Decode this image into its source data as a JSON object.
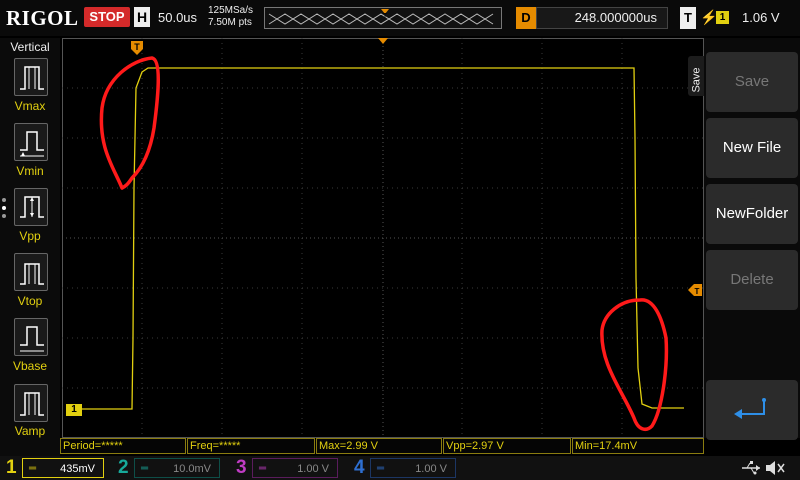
{
  "header": {
    "logo": "RIGOL",
    "run_state": "STOP",
    "timebase_label": "H",
    "timebase_value": "50.0us",
    "sample_rate": "125MSa/s",
    "memory_depth": "7.50M pts",
    "delay_label": "D",
    "delay_value": "248.000000us",
    "trigger_label": "T",
    "trigger_channel": "1",
    "trigger_level": "1.06 V"
  },
  "left_menu": {
    "title": "Vertical",
    "items": [
      {
        "label": "Vmax",
        "icon": "vmax-icon"
      },
      {
        "label": "Vmin",
        "icon": "vmin-icon"
      },
      {
        "label": "Vpp",
        "icon": "vpp-icon"
      },
      {
        "label": "Vtop",
        "icon": "vtop-icon"
      },
      {
        "label": "Vbase",
        "icon": "vbase-icon"
      },
      {
        "label": "Vamp",
        "icon": "vamp-icon"
      }
    ]
  },
  "right_menu": {
    "title": "Save",
    "buttons": [
      {
        "label": "Save",
        "enabled": false
      },
      {
        "label": "New File",
        "enabled": true
      },
      {
        "label": "NewFolder",
        "enabled": true
      },
      {
        "label": "Delete",
        "enabled": false
      },
      {
        "label": "",
        "icon": "enter-icon",
        "enabled": true
      }
    ]
  },
  "channel_markers": {
    "ch1_ground": "1"
  },
  "measurements": [
    {
      "text": "Period=*****"
    },
    {
      "text": "Freq=*****"
    },
    {
      "text": "Max=2.99 V"
    },
    {
      "text": "Vpp=2.97 V"
    },
    {
      "text": "Min=17.4mV"
    }
  ],
  "channels": [
    {
      "num": "1",
      "scale": "435mV",
      "color": "#e2d010",
      "active": true
    },
    {
      "num": "2",
      "scale": "10.0mV",
      "color": "#17a99a",
      "active": false
    },
    {
      "num": "3",
      "scale": "1.00 V",
      "color": "#c03cc4",
      "active": false
    },
    {
      "num": "4",
      "scale": "1.00 V",
      "color": "#2e6fd1",
      "active": false
    }
  ],
  "status_icons": [
    "usb-icon",
    "speaker-muted-icon"
  ],
  "colors": {
    "ch1": "#e2d010",
    "trigger_marker": "#e58b00",
    "annotation": "#ff1a1a",
    "stop": "#d42a2a"
  }
}
